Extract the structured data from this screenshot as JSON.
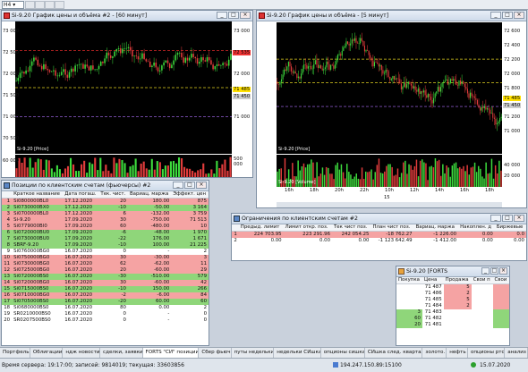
{
  "toolbar": {
    "timeframe": "H4"
  },
  "chart1": {
    "title": "Si-9.20 График цены и объёма #2 - [60 минут]",
    "price_axis": [
      "73 000",
      "72 500",
      "72 000",
      "71 500",
      "71 000",
      "70 500"
    ],
    "price_tags": [
      "72 535",
      "71 485",
      "71 450",
      "71 000"
    ],
    "series_label": "Si-9.20 [Price]",
    "volume_label": "60 000",
    "volume_axis": [
      "500 000"
    ]
  },
  "chart2": {
    "title": "Si-9.20 График цены и объёма - [5 минут]",
    "price_axis": [
      "72 600",
      "72 400",
      "72 200",
      "72 000",
      "71 800",
      "71 600",
      "71 400",
      "71 200",
      "71 000"
    ],
    "price_tags": [
      "71 485",
      "71 450"
    ],
    "series_label": "Si-9.20 [Price]",
    "volume_label": "Si-9.20 [Volume]",
    "volume_axis": [
      "40 000",
      "20 000"
    ],
    "time_ticks": [
      "16h",
      "18h",
      "20h",
      "22h",
      "10h",
      "12h",
      "14h",
      "16h",
      "18h"
    ],
    "date_tick": "15"
  },
  "positions": {
    "title": "Позиции по клиентским счетам (фьючерсы) #2",
    "headers": [
      "",
      "Краткое название",
      "Дата погаш.",
      "Тек. чист.",
      "Вариац. маржа",
      "Эффект. цен"
    ],
    "rows": [
      {
        "n": "1",
        "name": "Si0800000BL0",
        "date": "17.12.2020",
        "qty": "20",
        "vm": "180.00",
        "eff": "875",
        "c": "rr"
      },
      {
        "n": "2",
        "name": "Si0730000BX0",
        "date": "17.12.2020",
        "qty": "-10",
        "vm": "-50.00",
        "eff": "3 164",
        "c": "rg"
      },
      {
        "n": "3",
        "name": "Si0700000BL0",
        "date": "17.12.2020",
        "qty": "6",
        "vm": "-132.00",
        "eff": "3 759",
        "c": "rr"
      },
      {
        "n": "4",
        "name": "Si-9.20",
        "date": "17.09.2020",
        "qty": "30",
        "vm": "-750.00",
        "eff": "71 513",
        "c": "rr"
      },
      {
        "n": "5",
        "name": "Si0779000BI0",
        "date": "17.09.2020",
        "qty": "60",
        "vm": "-480.00",
        "eff": "10",
        "c": "rr"
      },
      {
        "n": "6",
        "name": "Si0720000BU0",
        "date": "17.09.2020",
        "qty": "-6",
        "vm": "-48.00",
        "eff": "1 970",
        "c": "rg"
      },
      {
        "n": "7",
        "name": "Si0730000BU0",
        "date": "17.09.2020",
        "qty": "-22",
        "vm": "176.00",
        "eff": "1 671",
        "c": "rg"
      },
      {
        "n": "8",
        "name": "SBRF-9.20",
        "date": "17.09.2020",
        "qty": "-10",
        "vm": "100.00",
        "eff": "21 225",
        "c": "rg"
      },
      {
        "n": "9",
        "name": "Si0760000BG0",
        "date": "16.07.2020",
        "qty": "0",
        "vm": "-",
        "eff": "2",
        "c": "rw"
      },
      {
        "n": "10",
        "name": "Si0750000BG0",
        "date": "16.07.2020",
        "qty": "30",
        "vm": "-30.00",
        "eff": "3",
        "c": "rr"
      },
      {
        "n": "11",
        "name": "Si0730000BG0",
        "date": "16.07.2020",
        "qty": "62",
        "vm": "-62.00",
        "eff": "11",
        "c": "rr"
      },
      {
        "n": "12",
        "name": "Si0725000BG0",
        "date": "16.07.2020",
        "qty": "20",
        "vm": "-60.00",
        "eff": "29",
        "c": "rr"
      },
      {
        "n": "13",
        "name": "Si0720000BS0",
        "date": "16.07.2020",
        "qty": "-30",
        "vm": "-510.00",
        "eff": "579",
        "c": "rg"
      },
      {
        "n": "14",
        "name": "Si0720000BG0",
        "date": "16.07.2020",
        "qty": "30",
        "vm": "-60.00",
        "eff": "42",
        "c": "rr"
      },
      {
        "n": "15",
        "name": "Si0715000BS0",
        "date": "16.07.2020",
        "qty": "-10",
        "vm": "150.00",
        "eff": "266",
        "c": "rg"
      },
      {
        "n": "16",
        "name": "Si0710000BG0",
        "date": "16.07.2020",
        "qty": "-2",
        "vm": "-6.00",
        "eff": "84",
        "c": "rr"
      },
      {
        "n": "17",
        "name": "Si0705000BS0",
        "date": "16.07.2020",
        "qty": "-20",
        "vm": "60.00",
        "eff": "60",
        "c": "rg"
      },
      {
        "n": "18",
        "name": "Si0680000BS0",
        "date": "16.07.2020",
        "qty": "80",
        "vm": "0.00",
        "eff": "2",
        "c": "rw"
      },
      {
        "n": "19",
        "name": "SR0210000BS0",
        "date": "16.07.2020",
        "qty": "0",
        "vm": "-",
        "eff": "0",
        "c": "rw"
      },
      {
        "n": "20",
        "name": "SR0207500BS0",
        "date": "16.07.2020",
        "qty": "0",
        "vm": "-",
        "eff": "0",
        "c": "rw"
      }
    ]
  },
  "limits": {
    "title": "Ограничения по клиентским счетам #2",
    "headers": [
      "",
      "Предыд. лимит",
      "Лимит откр. поз.",
      "Тек чист поз.",
      "План чист поз.",
      "Вариац. маржа",
      "Накоплен. д",
      "Биржевые"
    ],
    "rows": [
      {
        "n": "1",
        "prev": "224 703.95",
        "lim": "223 291.96",
        "cur": "242 054.25",
        "plan": "-18 762.27",
        "vm": "-1 226.00",
        "acc": "0.00",
        "ex": "0.0",
        "c": "rr"
      },
      {
        "n": "2",
        "prev": "0.00",
        "lim": "0.00",
        "cur": "0.00",
        "plan": "-1 123 642.49",
        "vm": "-1 412.00",
        "acc": "0.00",
        "ex": "0.00",
        "c": "rw"
      }
    ]
  },
  "book": {
    "title": "Si-9.20 [FORTS",
    "headers": [
      "Покупка",
      "Цена",
      "Продажа",
      "Свои п",
      "Свои"
    ],
    "rows": [
      {
        "buy": "",
        "price": "71 487",
        "sell": "5",
        "c": "rr"
      },
      {
        "buy": "",
        "price": "71 486",
        "sell": "2",
        "c": "rr"
      },
      {
        "buy": "",
        "price": "71 485",
        "sell": "5",
        "c": "rr"
      },
      {
        "buy": "",
        "price": "71 484",
        "sell": "2",
        "c": "rr"
      },
      {
        "buy": "3",
        "price": "71 483",
        "sell": "",
        "c": "rg"
      },
      {
        "buy": "60",
        "price": "71 482",
        "sell": "",
        "c": "rg"
      },
      {
        "buy": "20",
        "price": "71 481",
        "sell": "",
        "c": "rg"
      }
    ]
  },
  "tabs": [
    "Портфель",
    "Облигации",
    "ндж новости",
    "сделки, заявки",
    "FORTS \"СИ\" позиции,",
    "Сбер фьюч",
    "путы недельки",
    "недельки СИшка",
    "опционы сишка",
    "СИшка след. квартал",
    "золото.",
    "нефть",
    "опционы ртс",
    "анализ"
  ],
  "active_tab": 4,
  "status": {
    "server_time": "Время сервера: 19:17:00; записей: 9814019; текущая: 33603856",
    "ip": "194.247.150.89:15100",
    "date": "15.07.2020"
  }
}
